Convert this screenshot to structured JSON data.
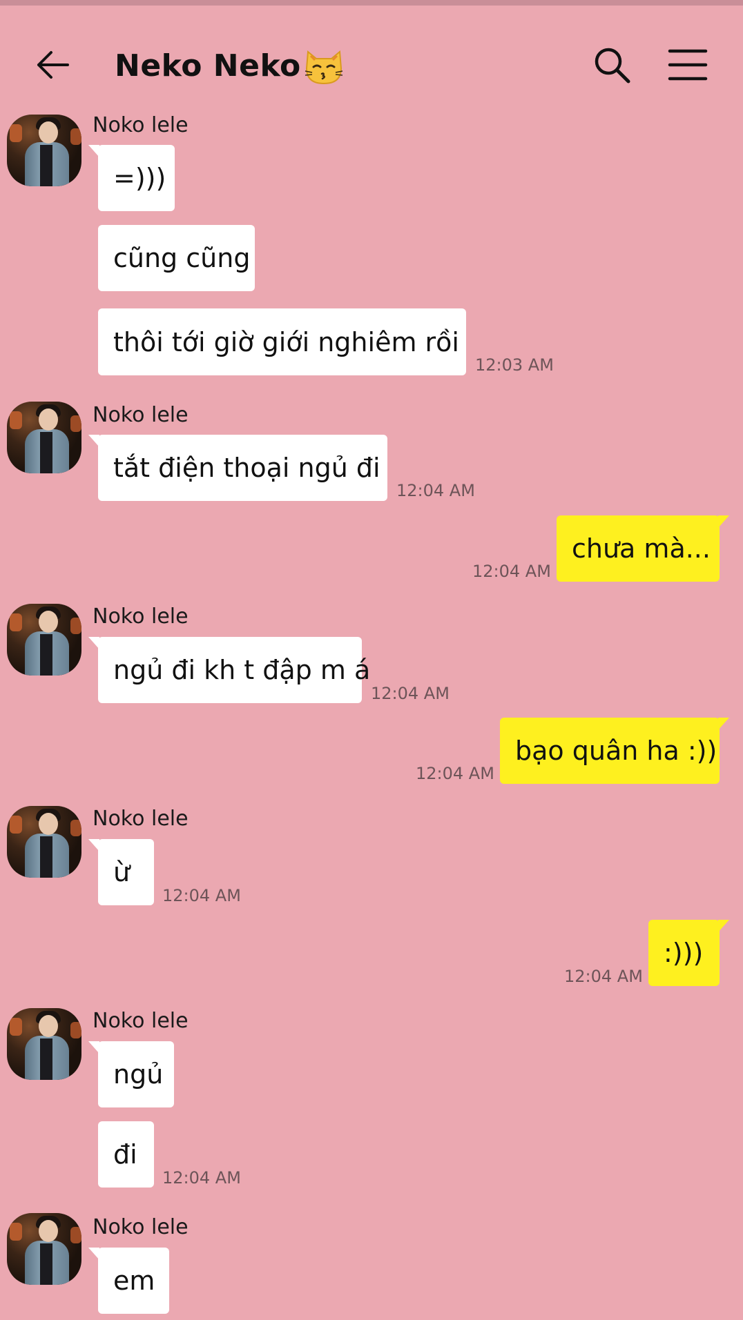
{
  "header": {
    "title": "Neko Neko",
    "title_emoji": "kissing-cat-emoji",
    "back_icon": "arrow-left-icon",
    "search_icon": "search-icon",
    "menu_icon": "hamburger-menu-icon"
  },
  "colors": {
    "background": "#eba8b1",
    "incoming_bubble": "#ffffff",
    "outgoing_bubble": "#fef01f",
    "timestamp": "#6d5458"
  },
  "conversation": [
    {
      "direction": "in",
      "sender": "Noko lele",
      "messages": [
        "=)))",
        "cũng cũng",
        "thôi tới giờ giới nghiêm rồi"
      ],
      "time": "12:03 AM"
    },
    {
      "direction": "in",
      "sender": "Noko lele",
      "messages": [
        "tắt điện thoại ngủ đi"
      ],
      "time": "12:04 AM"
    },
    {
      "direction": "out",
      "messages": [
        "chưa mà..."
      ],
      "time": "12:04 AM"
    },
    {
      "direction": "in",
      "sender": "Noko lele",
      "messages": [
        "ngủ đi kh t đập m á"
      ],
      "time": "12:04 AM"
    },
    {
      "direction": "out",
      "messages": [
        "bạo quân ha :))"
      ],
      "time": "12:04 AM"
    },
    {
      "direction": "in",
      "sender": "Noko lele",
      "messages": [
        "ừ"
      ],
      "time": "12:04 AM"
    },
    {
      "direction": "out",
      "messages": [
        ":)))"
      ],
      "time": "12:04 AM"
    },
    {
      "direction": "in",
      "sender": "Noko lele",
      "messages": [
        "ngủ",
        "đi"
      ],
      "time": "12:04 AM"
    },
    {
      "direction": "in",
      "sender": "Noko lele",
      "messages": [
        "em"
      ],
      "time": ""
    }
  ]
}
